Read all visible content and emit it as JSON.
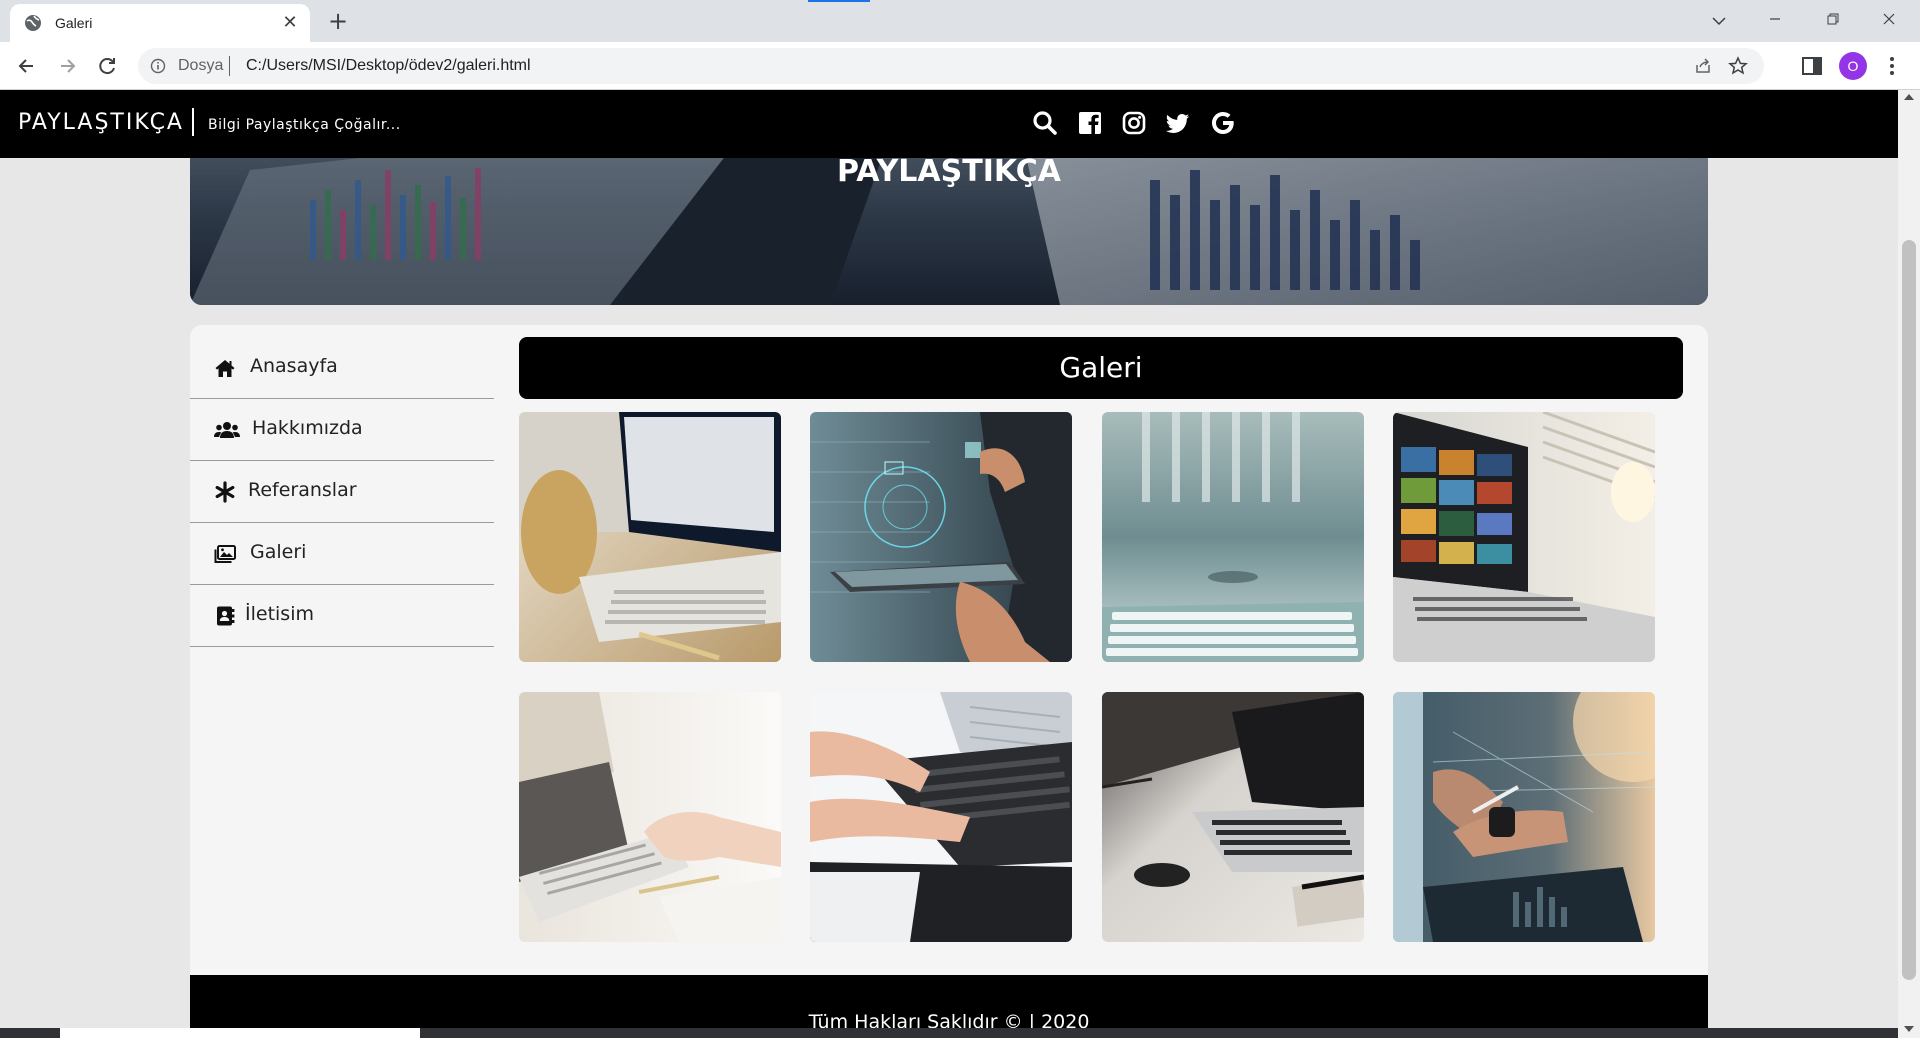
{
  "browser": {
    "tab_title": "Galeri",
    "site_label": "Dosya",
    "url": "C:/Users/MSI/Desktop/ödev2/galeri.html",
    "profile_initial": "O"
  },
  "navbar": {
    "brand": "PAYLAŞTIKÇA",
    "tagline": "Bilgi Paylaştıkça Çoğalır...",
    "social_icons": [
      "search-icon",
      "facebook-icon",
      "instagram-icon",
      "twitter-icon",
      "google-icon"
    ]
  },
  "hero": {
    "title": "PAYLAŞTIKÇA"
  },
  "sidebar": {
    "items": [
      {
        "label": "Anasayfa",
        "icon": "home-icon"
      },
      {
        "label": "Hakkımızda",
        "icon": "users-icon"
      },
      {
        "label": "Referanslar",
        "icon": "asterisk-icon"
      },
      {
        "label": "Galeri",
        "icon": "images-icon"
      },
      {
        "label": "İletisim",
        "icon": "contact-icon"
      }
    ]
  },
  "main": {
    "title": "Galeri"
  },
  "footer": {
    "text": "Tüm Hakları Saklıdır © | 2020"
  },
  "colors": {
    "navbar": "#000000",
    "page_bg": "#e7e7e7",
    "card_bg": "#f5f5f5",
    "profile": "#9334e6"
  }
}
